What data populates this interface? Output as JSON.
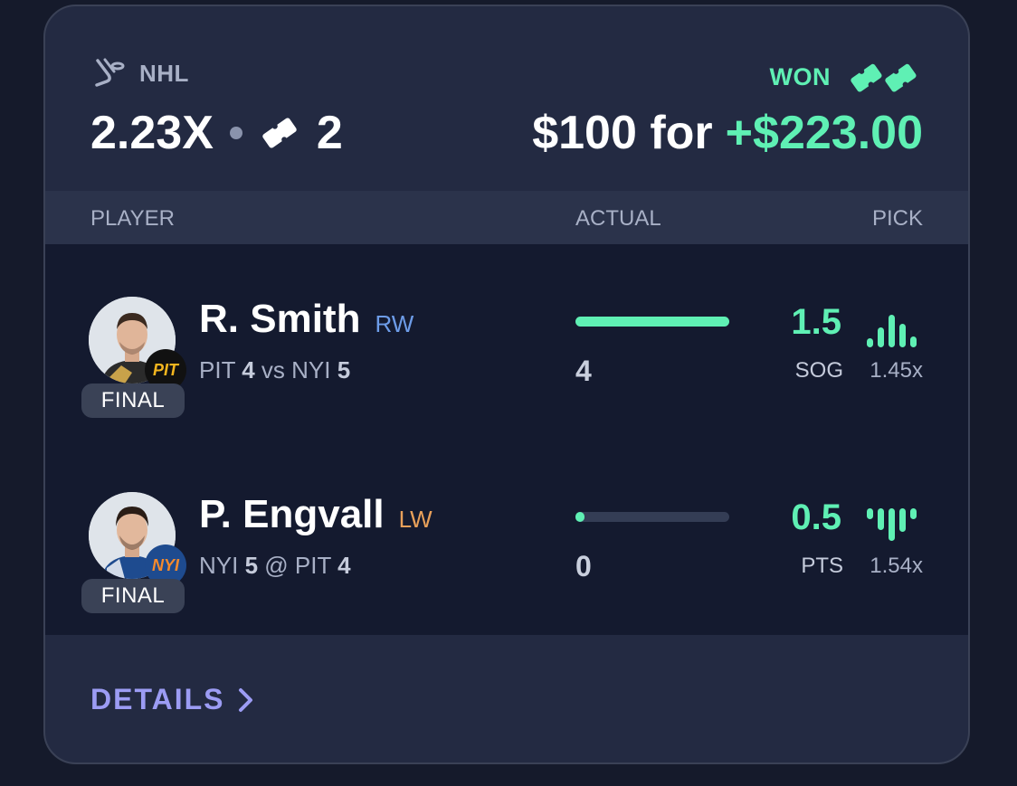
{
  "header": {
    "league": "NHL",
    "league_icon": "hockey-stick-icon",
    "result": "WON",
    "result_icon": "tickets-icon",
    "multiplier": "2.23X",
    "ticket_count": "2",
    "entry": "$100 for",
    "payout": "+$223.00"
  },
  "columns": {
    "player": "PLAYER",
    "actual": "ACTUAL",
    "pick": "PICK"
  },
  "players": [
    {
      "name": "R. Smith",
      "position": "RW",
      "team": "PIT",
      "team_score": "4",
      "connector": "vs",
      "opponent": "NYI",
      "opponent_score": "5",
      "status": "FINAL",
      "actual": "4",
      "progress": 1.0,
      "line": "1.5",
      "stat": "SOG",
      "multiplier": "1.45x",
      "trend_icon": "trend-up-icon"
    },
    {
      "name": "P. Engvall",
      "position": "LW",
      "team": "NYI",
      "team_score": "5",
      "connector": "@",
      "opponent": "PIT",
      "opponent_score": "4",
      "status": "FINAL",
      "actual": "0",
      "progress": 0.0,
      "line": "0.5",
      "stat": "PTS",
      "multiplier": "1.54x",
      "trend_icon": "trend-down-icon"
    }
  ],
  "footer": {
    "details": "DETAILS"
  },
  "colors": {
    "accent_green": "#5ff0b4",
    "details_purple": "#9c9cf4",
    "rw_blue": "#6d9ce8",
    "lw_orange": "#e8a05a",
    "pit_gold": "#f5b61e",
    "nyi_blue": "#1e4b8f",
    "nyi_orange": "#f58a2c"
  }
}
